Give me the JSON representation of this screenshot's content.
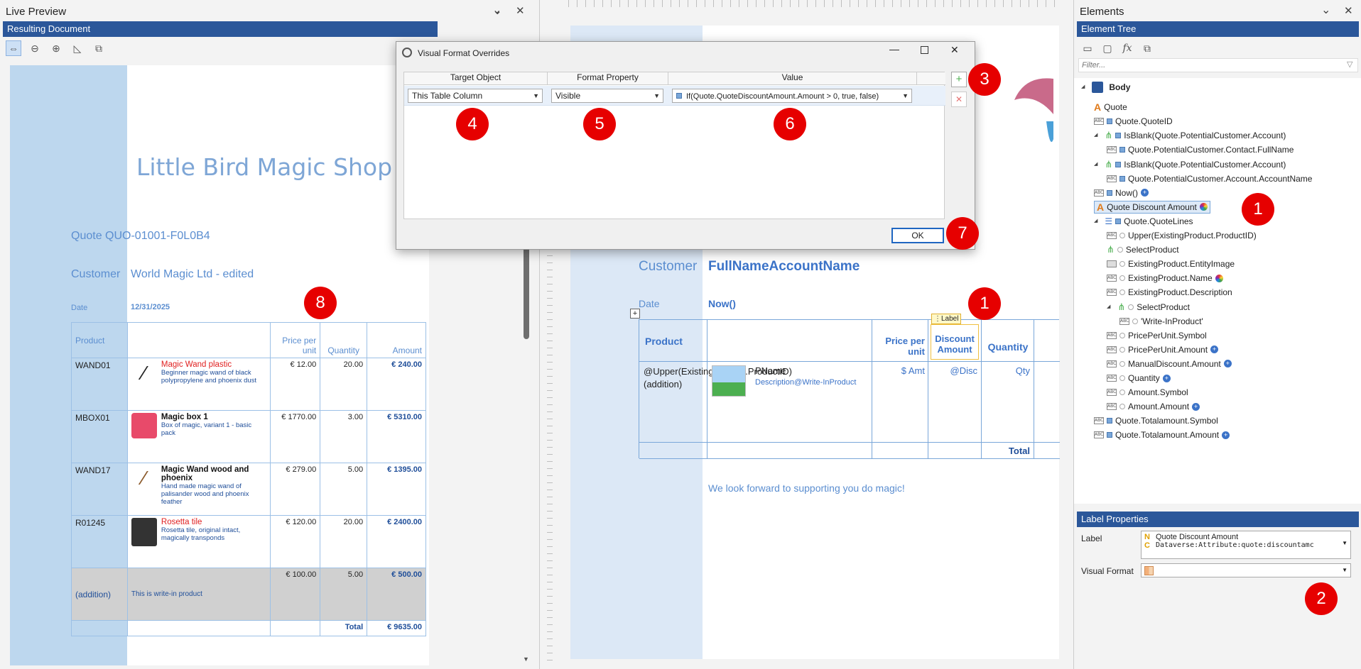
{
  "live_preview": {
    "title": "Live Preview",
    "bar": "Resulting Document",
    "company": "Little Bird Magic Shop",
    "quote_line": "Quote QUO-01001-F0L0B4",
    "customer_label": "Customer",
    "customer_name": "World Magic Ltd - edited",
    "date_label": "Date",
    "date_value": "12/31/2025",
    "table": {
      "headers": [
        "Product",
        "Price per unit",
        "Quantity",
        "Amount"
      ],
      "rows": [
        {
          "id": "WAND01",
          "name": "Magic Wand plastic",
          "desc": "Beginner magic wand of black polypropylene and phoenix dust",
          "price": "€ 12.00",
          "qty": "20.00",
          "amount": "€ 240.00",
          "red": true
        },
        {
          "id": "MBOX01",
          "name": "Magic box 1",
          "desc": "Box of magic, variant 1 - basic pack",
          "price": "€ 1770.00",
          "qty": "3.00",
          "amount": "€ 5310.00",
          "red": false
        },
        {
          "id": "WAND17",
          "name": "Magic Wand wood and phoenix",
          "desc": "Hand made magic wand of palisander wood and phoenix feather",
          "price": "€ 279.00",
          "qty": "5.00",
          "amount": "€ 1395.00",
          "red": false
        },
        {
          "id": "R01245",
          "name": "Rosetta tile",
          "desc": "Rosetta tile, original intact, magically transponds",
          "price": "€ 120.00",
          "qty": "20.00",
          "amount": "€ 2400.00",
          "red": true
        }
      ],
      "addition": {
        "id": "(addition)",
        "desc": "This is write-in product",
        "price": "€ 100.00",
        "qty": "5.00",
        "amount": "€ 500.00"
      },
      "total_label": "Total",
      "total_value": "€ 9635.00"
    }
  },
  "designer": {
    "customer_label": "Customer",
    "customer_field": "FullNameAccountName",
    "date_label": "Date",
    "date_field": "Now()",
    "label_tag": "Label",
    "headers": {
      "product": "Product",
      "price": "Price per unit",
      "discount": "Discount Amount",
      "quantity": "Quantity"
    },
    "row": {
      "product_expr": "@Upper(ExistingProduct.ProductID) (addition)",
      "pname": "PName",
      "desc": "Description@Write-InProduct",
      "amt": "$ Amt",
      "disc": "@Disc",
      "qty": "Qty"
    },
    "total_label": "Total",
    "footer": "We look forward to supporting you do magic!"
  },
  "dialog": {
    "title": "Visual Format Overrides",
    "columns": [
      "Target Object",
      "Format Property",
      "Value"
    ],
    "target": "This Table Column",
    "property": "Visible",
    "value": "If(Quote.QuoteDiscountAmount.Amount > 0, true, false)",
    "ok": "OK"
  },
  "elements": {
    "title": "Elements",
    "bar": "Element Tree",
    "filter_placeholder": "Filter...",
    "tree": [
      {
        "label": "Body",
        "icon": "body"
      },
      {
        "label": "Quote",
        "icon": "label"
      },
      {
        "label": "Quote.QuoteID",
        "icon": "abc"
      },
      {
        "label": "IsBlank(Quote.PotentialCustomer.Account)",
        "icon": "cond"
      },
      {
        "label": "Quote.PotentialCustomer.Contact.FullName",
        "icon": "abc"
      },
      {
        "label": "IsBlank(Quote.PotentialCustomer.Account)",
        "icon": "cond"
      },
      {
        "label": "Quote.PotentialCustomer.Account.AccountName",
        "icon": "abc"
      },
      {
        "label": "Now()",
        "icon": "abc"
      },
      {
        "label": "Quote Discount Amount",
        "icon": "label"
      },
      {
        "label": "Quote.QuoteLines",
        "icon": "list"
      },
      {
        "label": "Upper(ExistingProduct.ProductID)",
        "icon": "abc"
      },
      {
        "label": "SelectProduct",
        "icon": "cond"
      },
      {
        "label": "ExistingProduct.EntityImage",
        "icon": "img"
      },
      {
        "label": "ExistingProduct.Name",
        "icon": "abc"
      },
      {
        "label": "ExistingProduct.Description",
        "icon": "abc"
      },
      {
        "label": "SelectProduct",
        "icon": "cond"
      },
      {
        "label": "'Write-InProduct'",
        "icon": "abc"
      },
      {
        "label": "PricePerUnit.Symbol",
        "icon": "abc"
      },
      {
        "label": "PricePerUnit.Amount",
        "icon": "abc"
      },
      {
        "label": "ManualDiscount.Amount",
        "icon": "abc"
      },
      {
        "label": "Quantity",
        "icon": "abc"
      },
      {
        "label": "Amount.Symbol",
        "icon": "abc"
      },
      {
        "label": "Amount.Amount",
        "icon": "abc"
      },
      {
        "label": "Quote.Totalamount.Symbol",
        "icon": "abc"
      },
      {
        "label": "Quote.Totalamount.Amount",
        "icon": "abc"
      }
    ],
    "props_bar": "Label Properties",
    "label_prop": "Label",
    "label_n": "Quote Discount Amount",
    "label_c": "Dataverse:Attribute:quote:discountamc",
    "visual_format_prop": "Visual Format"
  },
  "badges": [
    "1",
    "1",
    "2",
    "3",
    "4",
    "5",
    "6",
    "7",
    "8"
  ]
}
